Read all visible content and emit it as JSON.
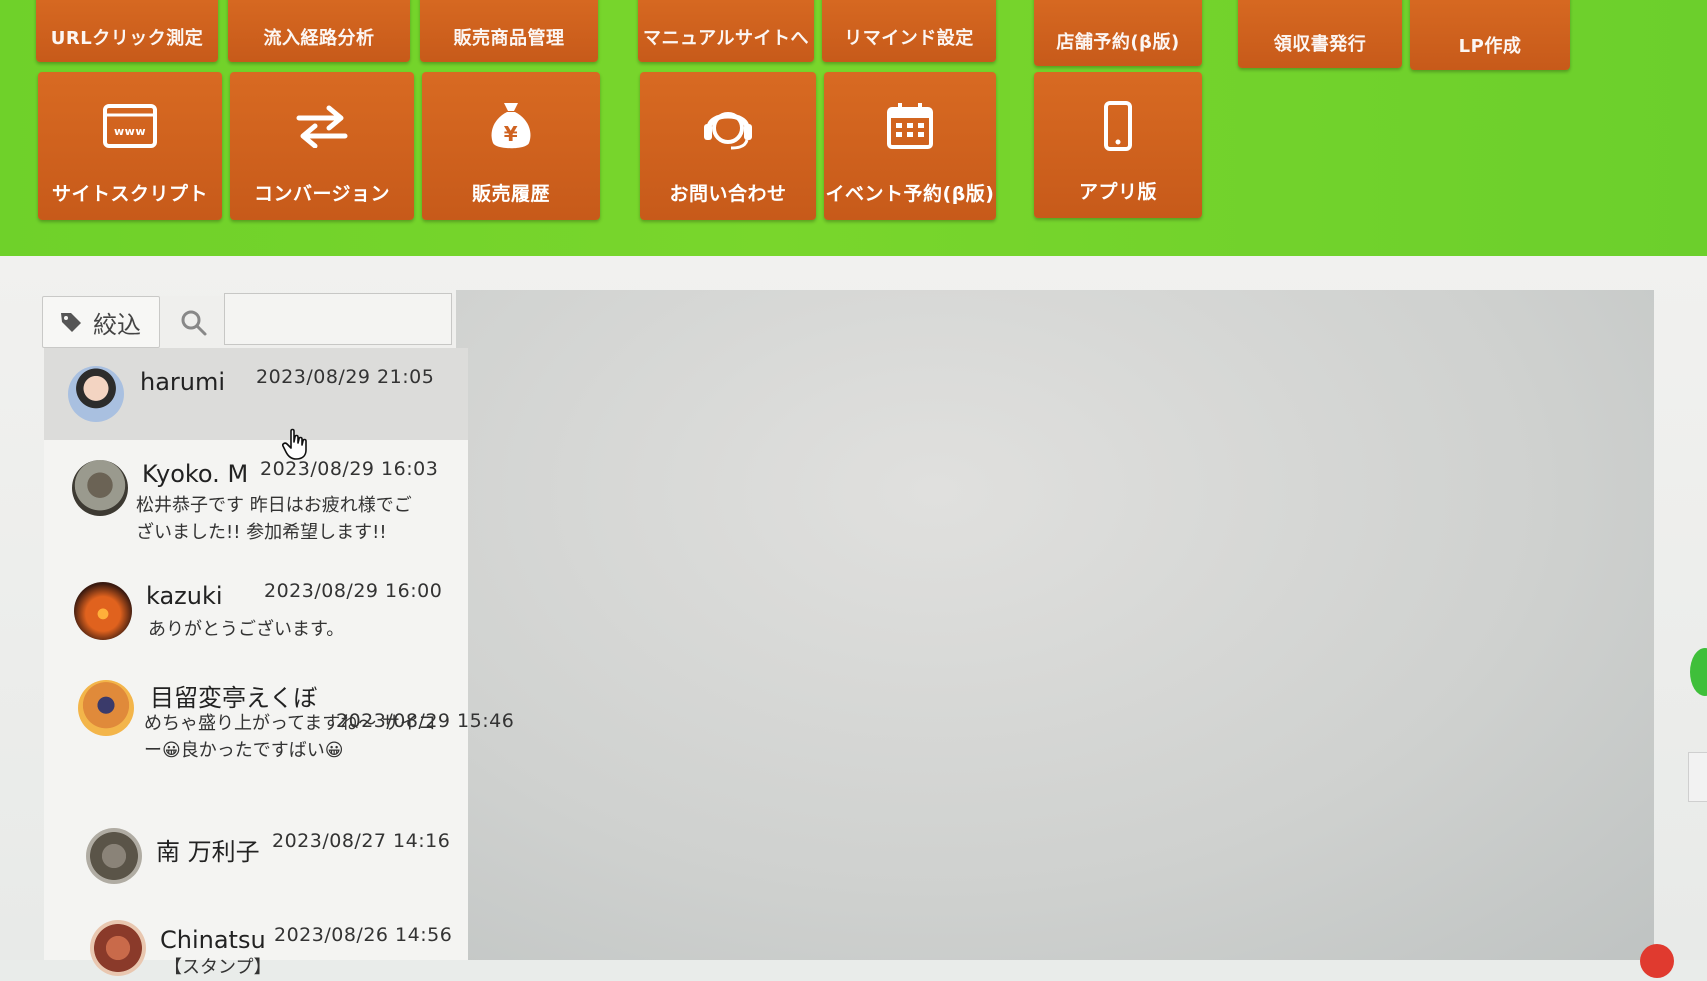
{
  "colors": {
    "header_green": "#74d42c",
    "tile_orange": "#cf6220",
    "panel_bg": "#eeeeec"
  },
  "top_row": [
    {
      "label": "URLクリック測定"
    },
    {
      "label": "流入経路分析"
    },
    {
      "label": "販売商品管理"
    },
    {
      "label": "マニュアルサイトへ"
    },
    {
      "label": "リマインド設定"
    },
    {
      "label": "店舗予約(β版)"
    },
    {
      "label": "領収書発行"
    },
    {
      "label": "LP作成"
    }
  ],
  "icon_row": [
    {
      "label": "サイトスクリプト",
      "icon": "browser-www-icon"
    },
    {
      "label": "コンバージョン",
      "icon": "swap-arrows-icon"
    },
    {
      "label": "販売履歴",
      "icon": "money-bag-yen-icon"
    },
    {
      "label": "お問い合わせ",
      "icon": "headset-icon"
    },
    {
      "label": "イベント予約(β版)",
      "icon": "calendar-icon"
    },
    {
      "label": "アプリ版",
      "icon": "smartphone-icon"
    }
  ],
  "filter": {
    "label": "絞込"
  },
  "conversations": [
    {
      "name": "harumi",
      "date": "2023/08/29 21:05",
      "message": ""
    },
    {
      "name": "Kyoko. M",
      "date": "2023/08/29 16:03",
      "message": "松井恭子です 昨日はお疲れ様でございました!! 参加希望します!!"
    },
    {
      "name": "kazuki",
      "date": "2023/08/29 16:00",
      "message": "ありがとうございます。"
    },
    {
      "name": "目留変亭えくぼ",
      "date": "2023/08/29 15:46",
      "message": "めちゃ盛り上がってますね〜 サイコー😀良かったですばい😀"
    },
    {
      "name": "南 万利子",
      "date": "2023/08/27 14:16",
      "message": ""
    },
    {
      "name": "Chinatsu",
      "date": "2023/08/26 14:56",
      "message": "【スタンプ】"
    }
  ]
}
